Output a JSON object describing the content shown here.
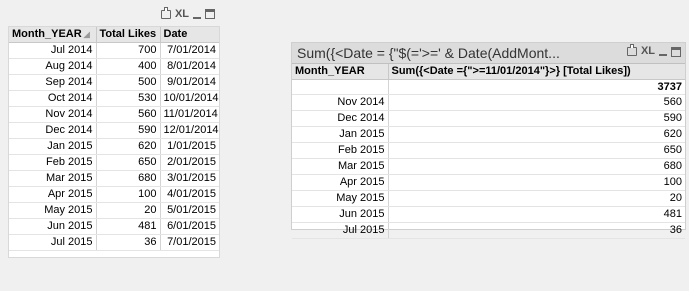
{
  "left_table": {
    "columns": [
      "Month_YEAR",
      "Total Likes",
      "Date"
    ],
    "rows": [
      [
        "Jul 2014",
        "700",
        "7/01/2014"
      ],
      [
        "Aug 2014",
        "400",
        "8/01/2014"
      ],
      [
        "Sep 2014",
        "500",
        "9/01/2014"
      ],
      [
        "Oct 2014",
        "530",
        "10/01/2014"
      ],
      [
        "Nov 2014",
        "560",
        "11/01/2014"
      ],
      [
        "Dec 2014",
        "590",
        "12/01/2014"
      ],
      [
        "Jan 2015",
        "620",
        "1/01/2015"
      ],
      [
        "Feb 2015",
        "650",
        "2/01/2015"
      ],
      [
        "Mar 2015",
        "680",
        "3/01/2015"
      ],
      [
        "Apr 2015",
        "100",
        "4/01/2015"
      ],
      [
        "May 2015",
        "20",
        "5/01/2015"
      ],
      [
        "Jun 2015",
        "481",
        "6/01/2015"
      ],
      [
        "Jul 2015",
        "36",
        "7/01/2015"
      ]
    ],
    "caption_icons": [
      "print-icon",
      "xl-icon",
      "minimize-icon",
      "restore-icon"
    ],
    "xl_label": "XL"
  },
  "right_chart": {
    "title": "Sum({<Date = {\"$(='>=' & Date(AddMont...",
    "columns": [
      "Month_YEAR",
      "Sum({<Date ={\">=11/01/2014\"}>} [Total Likes])"
    ],
    "total": "3737",
    "rows": [
      [
        "Nov 2014",
        "560"
      ],
      [
        "Dec 2014",
        "590"
      ],
      [
        "Jan 2015",
        "620"
      ],
      [
        "Feb 2015",
        "650"
      ],
      [
        "Mar 2015",
        "680"
      ],
      [
        "Apr 2015",
        "100"
      ],
      [
        "May 2015",
        "20"
      ],
      [
        "Jun 2015",
        "481"
      ],
      [
        "Jul 2015",
        "36"
      ]
    ],
    "caption_icons": [
      "print-icon",
      "xl-icon",
      "minimize-icon",
      "restore-icon"
    ],
    "xl_label": "XL"
  }
}
